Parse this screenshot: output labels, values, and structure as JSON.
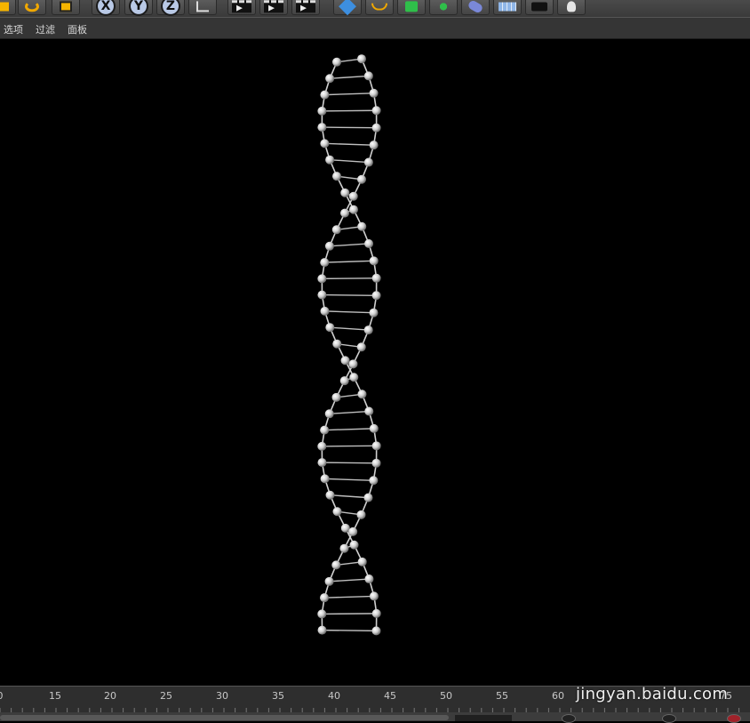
{
  "toolbar": {
    "buttons": [
      {
        "id": "render-region",
        "icon": "cube-yellow-icon"
      },
      {
        "id": "rotate",
        "icon": "rotate-icon"
      },
      {
        "id": "scale",
        "icon": "scale-icon"
      },
      {
        "id": "axis-x",
        "icon": "x-axis-icon",
        "label": "X"
      },
      {
        "id": "axis-y",
        "icon": "y-axis-icon",
        "label": "Y"
      },
      {
        "id": "axis-z",
        "icon": "z-axis-icon",
        "label": "Z"
      },
      {
        "id": "coord",
        "icon": "coordinate-system-icon"
      },
      {
        "id": "render-view",
        "icon": "clapboard-icon"
      },
      {
        "id": "render-picture",
        "icon": "clapboard-icon"
      },
      {
        "id": "render-settings",
        "icon": "clapboard-icon"
      },
      {
        "id": "cube",
        "icon": "cube-primitive-icon"
      },
      {
        "id": "spline",
        "icon": "spline-pen-icon"
      },
      {
        "id": "nurbs",
        "icon": "subdivision-icon"
      },
      {
        "id": "mograph",
        "icon": "cloner-icon"
      },
      {
        "id": "deformer",
        "icon": "bend-deformer-icon"
      },
      {
        "id": "floor",
        "icon": "floor-icon"
      },
      {
        "id": "camera",
        "icon": "camera-icon"
      },
      {
        "id": "light",
        "icon": "light-bulb-icon"
      }
    ]
  },
  "menubar": {
    "items": [
      "选项",
      "过滤",
      "面板"
    ]
  },
  "timeline": {
    "ticks": [
      "0",
      "15",
      "20",
      "25",
      "30",
      "35",
      "40",
      "45",
      "50",
      "55",
      "60",
      "",
      "70",
      "75"
    ]
  },
  "watermark": "jingyan.baidu.com",
  "colors": {
    "background": "#000000",
    "sphere": "#d9d9d9",
    "rung": "#bfbfbf"
  }
}
